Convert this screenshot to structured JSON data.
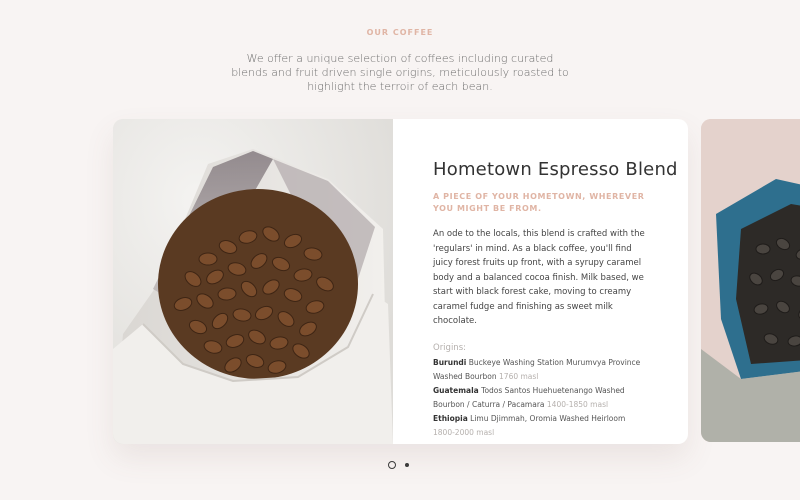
{
  "section": {
    "label": "OUR COFFEE",
    "intro": "We offer a unique selection of coffees including curated blends and fruit driven single origins, meticulously roasted to highlight the terroir of each bean."
  },
  "card": {
    "title": "Hometown Espresso Blend",
    "subtitle": "A PIECE OF YOUR HOMETOWN, WHEREVER YOU MIGHT BE FROM.",
    "description": "An ode to the locals, this blend is crafted with the 'regulars' in mind. As a black coffee, you'll find juicy forest fruits up front, with a syrupy caramel body and a balanced cocoa finish. Milk based, we start with black forest cake, moving to creamy caramel fudge and finishing as sweet milk chocolate.",
    "origins_label": "Origins:",
    "origins": [
      {
        "country": "Burundi",
        "details": "Buckeye Washing Station Murumvya Province Washed Bourbon",
        "altitude": "1760 masl"
      },
      {
        "country": "Guatemala",
        "details": "Todos Santos Huehuetenango Washed Bourbon / Caturra / Pacamara",
        "altitude": "1400-1850 masl"
      },
      {
        "country": "Ethiopia",
        "details": "Limu Djimmah, Oromia Washed Heirloom",
        "altitude": "1800-2000 masl"
      }
    ]
  },
  "carousel": {
    "slides": 2,
    "active_slide": 1
  }
}
